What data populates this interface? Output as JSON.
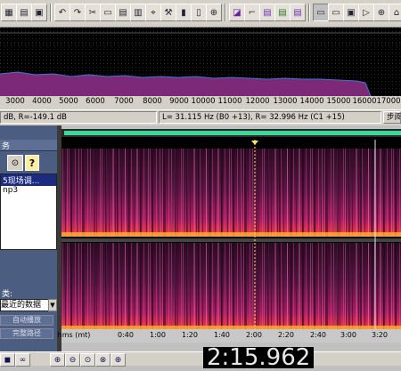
{
  "toolbar": {
    "icons": [
      "grid-icon",
      "open-icon",
      "save-icon",
      "multitrack-icon",
      "undo-icon",
      "redo-icon",
      "cut-icon",
      "copy-icon",
      "paste-icon",
      "mix-paste-icon",
      "trim-icon",
      "tools-icon",
      "spectral-icon",
      "loop-icon",
      "select-all-icon",
      "view-icon",
      "waveform-view-icon",
      "spectral-view-icon",
      "pan-view-icon",
      "phase-view-icon",
      "play-icon",
      "stop-icon",
      "zoom-icon"
    ]
  },
  "freq_ruler": {
    "ticks": [
      "3000",
      "4000",
      "5000",
      "6000",
      "7000",
      "8000",
      "9000",
      "10000",
      "11000",
      "12000",
      "13000",
      "14000",
      "15000",
      "16000",
      "17000"
    ]
  },
  "status": {
    "db_readout": "dB, R=-149.1 dB",
    "freq_readout": "L= 31.115 Hz (B0 +13), R= 32.996 Hz (C1 +15)",
    "right_button": "步阅"
  },
  "left_panel": {
    "header_label": "务",
    "file_name": "5现场调...",
    "file_ext": "np3",
    "category_label": "类:",
    "select_value": "最近的数据",
    "btn_1": "自动播放",
    "btn_2": "完整路径"
  },
  "timeline": {
    "unit": "hms (mt)",
    "ticks": [
      "0:40",
      "1:00",
      "1:20",
      "1:40",
      "2:00",
      "2:20",
      "2:40",
      "3:00",
      "3:20"
    ]
  },
  "timer": "2:15.962",
  "colors": {
    "accent": "#3ed69a",
    "spectrogram_hot": "#ff7a1a",
    "spectrogram_mid": "#b81f6d",
    "left_panel": "#4b5d81"
  }
}
